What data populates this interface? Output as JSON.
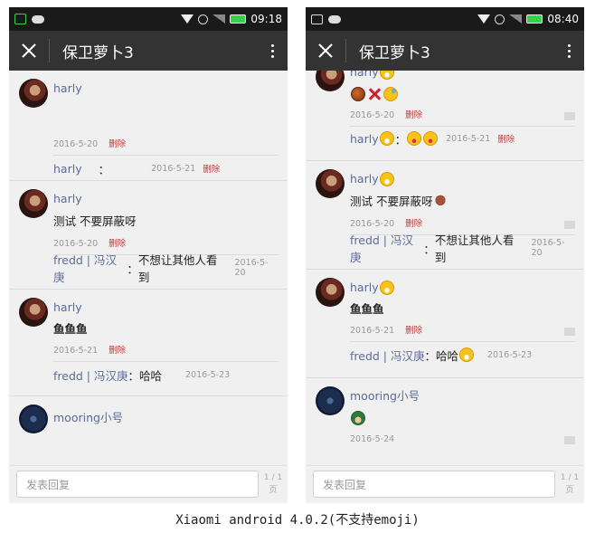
{
  "left": {
    "status_time": "09:18",
    "title": "保卫萝卜3",
    "posts": [
      {
        "author": "harly",
        "text": "",
        "date": "2016-5-20",
        "del": "删除",
        "replies": [
          {
            "name": "harly",
            "sep": "：",
            "text": "",
            "date": "2016-5-21",
            "del": "删除"
          }
        ]
      },
      {
        "author": "harly",
        "text": "测试 不要屏蔽呀",
        "date": "2016-5-20",
        "del": "删除",
        "replies": [
          {
            "name": "fredd | 冯汉庚",
            "sep": "：",
            "text": "不想让其他人看到",
            "date": "2016-5-20"
          }
        ]
      },
      {
        "author": "harly",
        "text": "鱼鱼鱼",
        "date": "2016-5-21",
        "del": "删除",
        "replies": [
          {
            "name": "fredd | 冯汉庚",
            "sep": "：",
            "text": "哈哈",
            "date": "2016-5-23"
          }
        ]
      },
      {
        "author": "mooring小号",
        "text": "",
        "date": "",
        "del": "",
        "replies": []
      }
    ],
    "input_placeholder": "发表回复",
    "page_top": "1 / 1",
    "page_bottom": "页"
  },
  "right": {
    "status_time": "08:40",
    "title": "保卫萝卜3",
    "posts": [
      {
        "author": "harly",
        "text": "",
        "date": "2016-5-20",
        "del": "删除",
        "replies": [
          {
            "name": "harly",
            "sep": "：",
            "text": "",
            "date": "2016-5-21",
            "del": "删除"
          }
        ]
      },
      {
        "author": "harly",
        "text": "测试 不要屏蔽呀",
        "date": "2016-5-20",
        "del": "删除",
        "replies": [
          {
            "name": "fredd | 冯汉庚",
            "sep": "：",
            "text": "不想让其他人看到",
            "date": "2016-5-20"
          }
        ]
      },
      {
        "author": "harly",
        "text": "鱼鱼鱼",
        "date": "2016-5-21",
        "del": "删除",
        "replies": [
          {
            "name": "fredd | 冯汉庚",
            "sep": "：",
            "text": "哈哈",
            "date": "2016-5-23"
          }
        ]
      },
      {
        "author": "mooring小号",
        "text": "",
        "date": "2016-5-24",
        "del": "",
        "replies": []
      }
    ],
    "input_placeholder": "发表回复",
    "page_top": "1 / 1",
    "page_bottom": "页"
  },
  "caption": "Xiaomi android 4.0.2(不支持emoji)"
}
